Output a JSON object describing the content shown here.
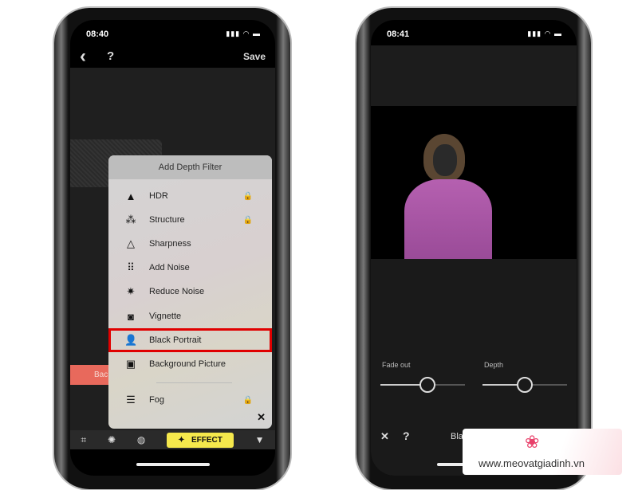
{
  "left_phone": {
    "time": "08:40",
    "status_icons": "signal wifi battery",
    "nav": {
      "back_icon": "‹",
      "help_label": "?",
      "save_label": "Save"
    },
    "partial_button": "Bac",
    "menu": {
      "title": "Add Depth Filter",
      "items": [
        {
          "label": "HDR",
          "icon": "mountain-icon",
          "glyph": "▲",
          "locked": true
        },
        {
          "label": "Structure",
          "icon": "structure-icon",
          "glyph": "⁂",
          "locked": true
        },
        {
          "label": "Sharpness",
          "icon": "triangle-icon",
          "glyph": "△",
          "locked": false
        },
        {
          "label": "Add Noise",
          "icon": "noise-icon",
          "glyph": "⠿",
          "locked": false
        },
        {
          "label": "Reduce Noise",
          "icon": "burst-icon",
          "glyph": "✷",
          "locked": false
        },
        {
          "label": "Vignette",
          "icon": "vignette-icon",
          "glyph": "◙",
          "locked": false
        },
        {
          "label": "Black Portrait",
          "icon": "portrait-icon",
          "glyph": "👤",
          "locked": false,
          "selected": true
        },
        {
          "label": "Background Picture",
          "icon": "picture-icon",
          "glyph": "▣",
          "locked": false
        },
        {
          "label": "Fog",
          "icon": "fog-icon",
          "glyph": "☰",
          "locked": true
        }
      ],
      "lock_glyph": "🔒",
      "close": "✕"
    },
    "toolbar": {
      "crop": "⌗",
      "aperture": "✺",
      "lens": "◍",
      "effect_label": "EFFECT",
      "effect_icon": "✦",
      "brush": "▼"
    },
    "highlight_color": "#e00000",
    "effect_color": "#f5e84c"
  },
  "right_phone": {
    "time": "08:41",
    "status_icons": "signal wifi battery",
    "sliders": [
      {
        "label": "Fade out",
        "value": 0.56
      },
      {
        "label": "Depth",
        "value": 0.5
      }
    ],
    "bottom": {
      "close": "✕",
      "help": "?",
      "partial_title": "Bla"
    }
  },
  "watermark": {
    "text": "www.meovatgiadinh.vn",
    "logo_color": "#e8406a"
  }
}
